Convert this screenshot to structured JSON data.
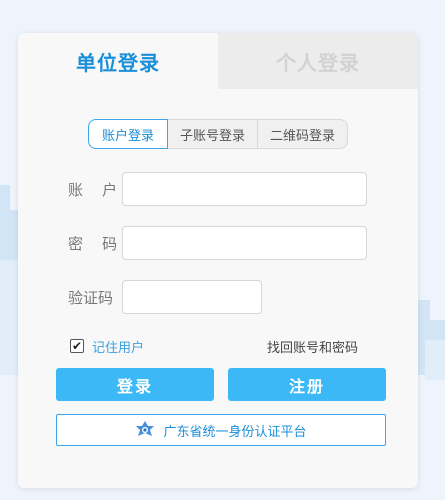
{
  "tabs": {
    "unit": "单位登录",
    "personal": "个人登录"
  },
  "subtabs": [
    "账户登录",
    "子账号登录",
    "二维码登录"
  ],
  "form": {
    "account_label": "账    户",
    "password_label": "密    码",
    "captcha_label": "验证码",
    "account_value": "",
    "password_value": "",
    "captcha_value": ""
  },
  "remember": {
    "checked": true,
    "label": "记住用户"
  },
  "forgot_label": "找回账号和密码",
  "buttons": {
    "login": "登录",
    "register": "注册"
  },
  "gd_auth": {
    "label": "广东省统一身份认证平台",
    "icon": "gd-auth-logo-icon"
  },
  "colors": {
    "accent": "#1a8fd8",
    "button": "#3cb8f6",
    "background": "#eef4fb"
  }
}
